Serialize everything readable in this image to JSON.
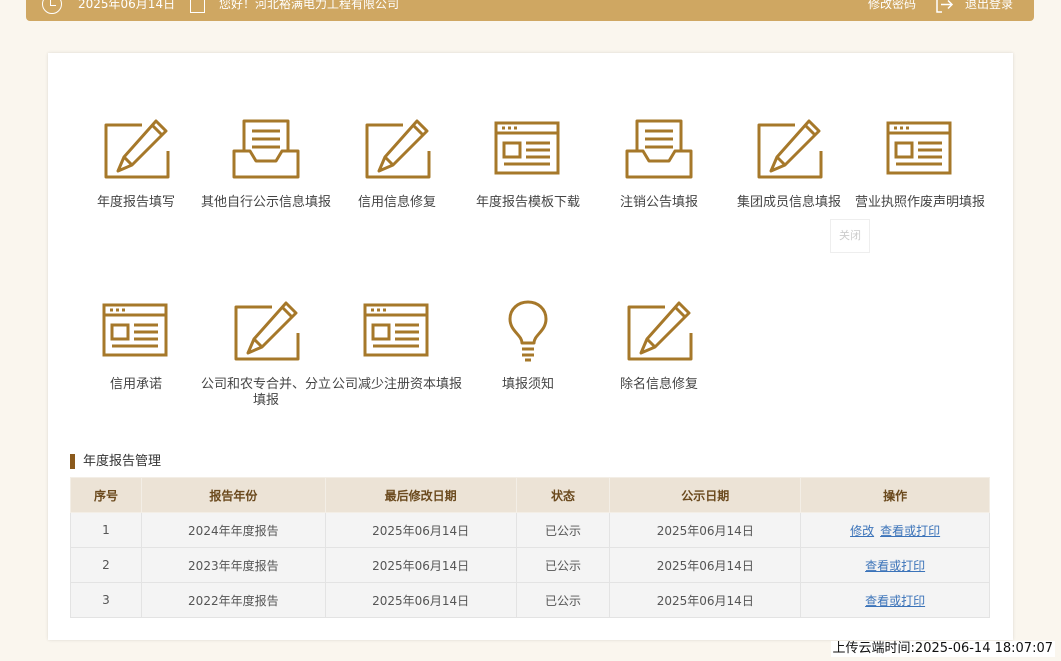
{
  "header": {
    "date": "2025年06月14日",
    "greeting": "您好！河北裕满电力工程有限公司",
    "change_password": "修改密码",
    "logout": "退出登录"
  },
  "tiles": [
    {
      "label": "年度报告填写",
      "icon": "edit-icon"
    },
    {
      "label": "其他自行公示信息填报",
      "icon": "inbox-icon"
    },
    {
      "label": "信用信息修复",
      "icon": "edit-icon"
    },
    {
      "label": "年度报告模板下载",
      "icon": "document-window-icon"
    },
    {
      "label": "注销公告填报",
      "icon": "inbox-icon"
    },
    {
      "label": "集团成员信息填报",
      "icon": "edit-icon"
    },
    {
      "label": "营业执照作废声明填报",
      "icon": "document-window-icon"
    },
    {
      "label": "信用承诺",
      "icon": "document-window-icon"
    },
    {
      "label": "公司和农专合并、分立填报",
      "icon": "edit-icon"
    },
    {
      "label": "公司减少注册资本填报",
      "icon": "document-window-icon"
    },
    {
      "label": "填报须知",
      "icon": "lightbulb-icon"
    },
    {
      "label": "除名信息修复",
      "icon": "edit-icon"
    }
  ],
  "close_tip": "关闭",
  "section": {
    "title": "年度报告管理"
  },
  "table": {
    "headers": [
      "序号",
      "报告年份",
      "最后修改日期",
      "状态",
      "公示日期",
      "操作"
    ],
    "rows": [
      {
        "no": "1",
        "year": "2024年年度报告",
        "modified": "2025年06月14日",
        "status": "已公示",
        "published": "2025年06月14日",
        "edit": "修改",
        "view": "查看或打印"
      },
      {
        "no": "2",
        "year": "2023年年度报告",
        "modified": "2025年06月14日",
        "status": "已公示",
        "published": "2025年06月14日",
        "view": "查看或打印"
      },
      {
        "no": "3",
        "year": "2022年年度报告",
        "modified": "2025年06月14日",
        "status": "已公示",
        "published": "2025年06月14日",
        "view": "查看或打印"
      }
    ]
  },
  "upload_time": "上传云端时间:2025-06-14 18:07:07",
  "colors": {
    "accent": "#a6782a",
    "topbar": "#cfa762",
    "link": "#3b73b9"
  }
}
